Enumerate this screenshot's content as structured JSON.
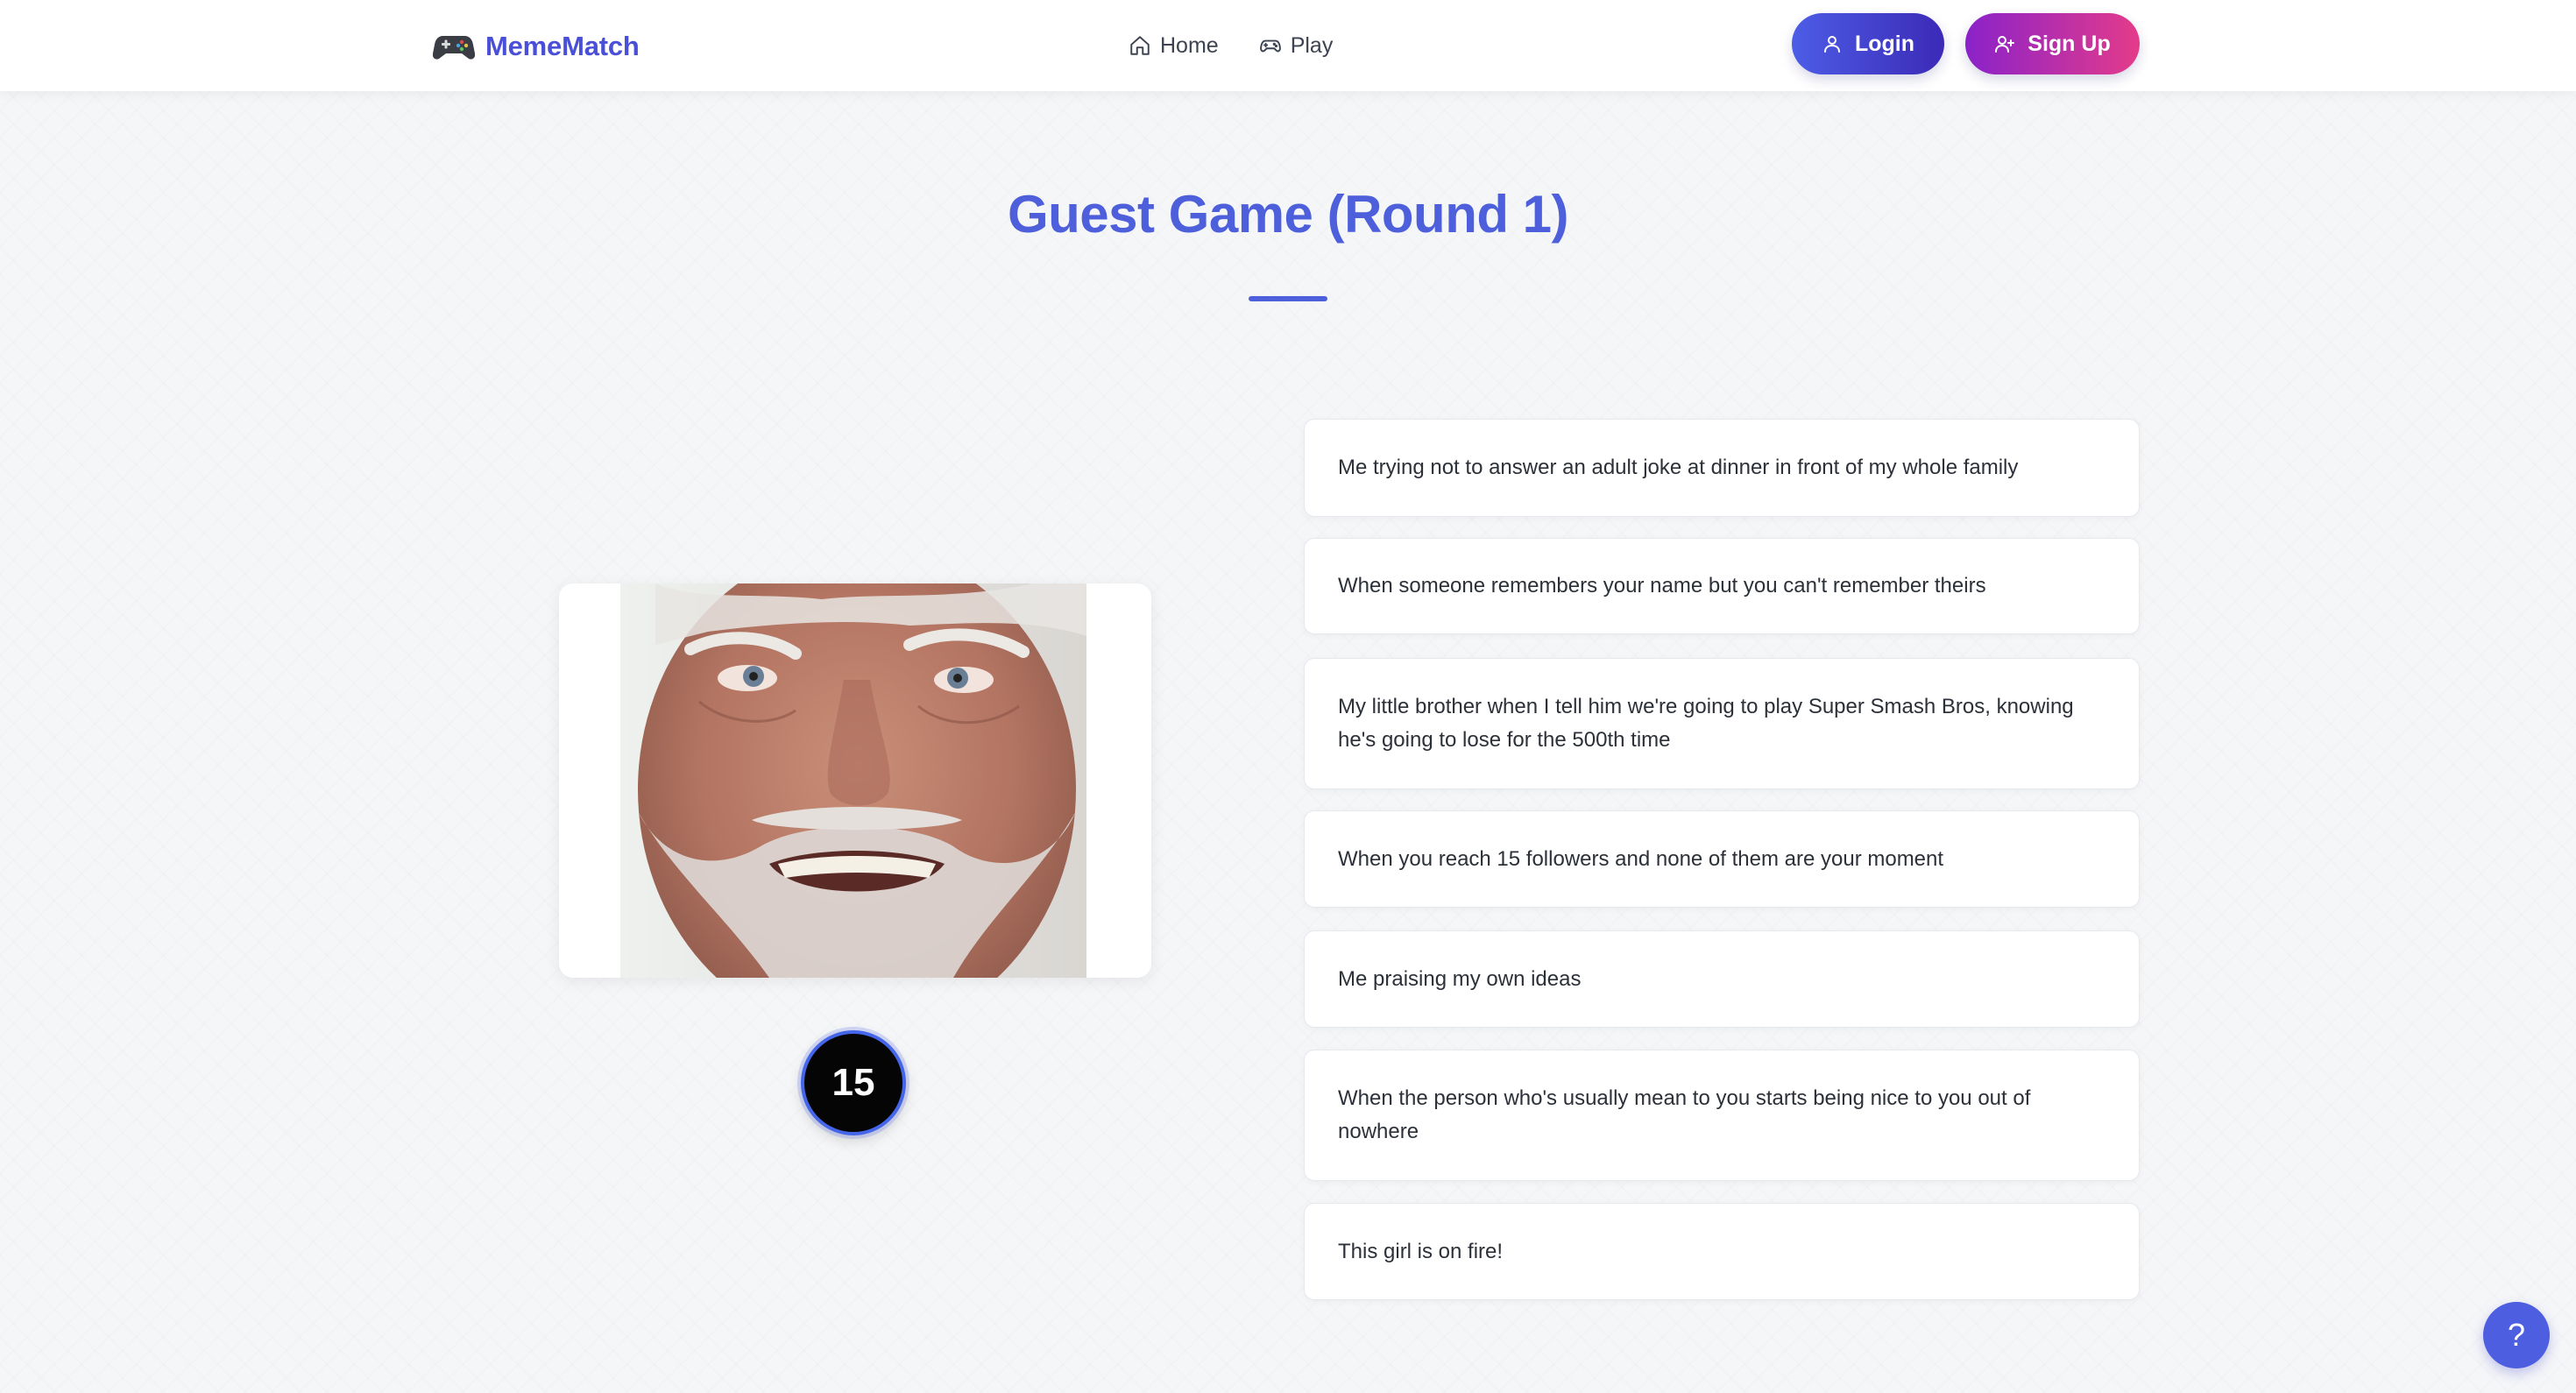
{
  "header": {
    "brand_name": "MemeMatch",
    "brand_icon": "gamepad-icon",
    "nav": [
      {
        "label": "Home",
        "icon": "home-icon"
      },
      {
        "label": "Play",
        "icon": "gamepad-icon"
      }
    ],
    "login_label": "Login",
    "signup_label": "Sign Up"
  },
  "game": {
    "title": "Guest Game (Round 1)",
    "timer": "15",
    "captions": [
      "Me trying not to answer an adult joke at dinner in front of my whole family",
      "When someone remembers your name but you can't remember theirs",
      "My little brother when I tell him we're going to play Super Smash Bros, knowing he's going to lose for the 500th time",
      "When you reach 15 followers and none of them are your moment",
      "Me praising my own ideas",
      "When the person who's usually mean to you starts being nice to you out of nowhere",
      "This girl is on fire!"
    ]
  },
  "help_label": "?",
  "colors": {
    "accent": "#4d5fda",
    "login_gradient": [
      "#4d5de6",
      "#3b2ab7"
    ],
    "signup_gradient": [
      "#8a22c9",
      "#e43b8a"
    ],
    "timer_ring": "#4566e8"
  }
}
